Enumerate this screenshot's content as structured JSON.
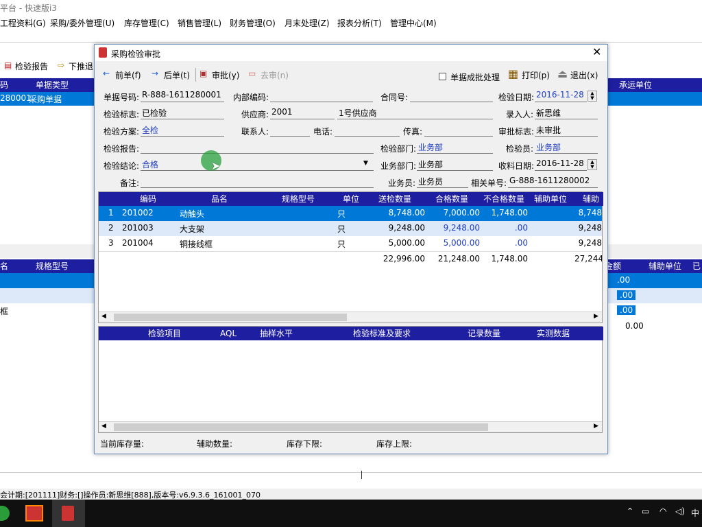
{
  "app": {
    "title": "平台 - 快速版i3",
    "menus": [
      "工程资料(G)",
      "采购/委外管理(U)",
      "库存管理(C)",
      "销售管理(L)",
      "财务管理(O)",
      "月末处理(Z)",
      "报表分析(T)",
      "管理中心(M)"
    ],
    "toolbar": {
      "inspect_report": "检验报告",
      "push_down": "下推退"
    },
    "upper_grid": {
      "headers": [
        "码",
        "单据类型",
        "承运单位"
      ],
      "row": {
        "code": "280001",
        "type": "采购单据"
      }
    },
    "lower_grid": {
      "headers": [
        "名",
        "规格型号",
        "金额",
        "辅助单位",
        "已"
      ],
      "amounts": [
        ".00",
        ".00",
        ".00",
        "0.00"
      ],
      "row3_name": "框"
    },
    "status_bar": "会计期:[201111]财务:[]操作员:新思维[888],版本号:v6.9.3.6_161001_070"
  },
  "dialog": {
    "title": "采购检验审批",
    "toolbar": {
      "prev": "前单(f)",
      "next": "后单(t)",
      "approve": "审批(y)",
      "unapprove": "去审(n)",
      "batch_checkbox": "单据成批处理",
      "print": "打印(p)",
      "exit": "退出(x)"
    },
    "fields": {
      "doc_no_label": "单据号码:",
      "doc_no": "R-888-1611280001",
      "internal_code_label": "内部编码:",
      "contract_no_label": "合同号:",
      "inspect_date_label": "检验日期:",
      "inspect_date": "2016-11-28",
      "inspect_flag_label": "检验标志:",
      "inspect_flag": "已检验",
      "supplier_label": "供应商:",
      "supplier_code": "2001",
      "supplier_name": "1号供应商",
      "entered_by_label": "录入人:",
      "entered_by": "新思维",
      "plan_label": "检验方案:",
      "plan": "全检",
      "contact_label": "联系人:",
      "phone_label": "电话:",
      "fax_label": "传真:",
      "approve_flag_label": "审批标志:",
      "approve_flag": "未审批",
      "report_label": "检验报告:",
      "inspect_dept_label": "检验部门:",
      "inspect_dept": "业务部",
      "inspector_label": "检验员:",
      "inspector": "业务部",
      "conclusion_label": "检验结论:",
      "conclusion": "合格",
      "biz_dept_label": "业务部门:",
      "biz_dept": "业务部",
      "receive_date_label": "收料日期:",
      "receive_date": "2016-11-28",
      "remark_label": "备注:",
      "salesman_label": "业务员:",
      "salesman": "业务员",
      "related_no_label": "相关单号:",
      "related_no": "G-888-1611280002"
    },
    "items_table": {
      "headers": [
        "编码",
        "品名",
        "规格型号",
        "单位",
        "送检数量",
        "合格数量",
        "不合格数量",
        "辅助单位",
        "辅助"
      ],
      "rows": [
        {
          "idx": "1",
          "code": "201002",
          "name": "动触头",
          "spec": "",
          "unit": "只",
          "sent": "8,748.00",
          "pass": "7,000.00",
          "fail": "1,748.00",
          "aux": "8,748"
        },
        {
          "idx": "2",
          "code": "201003",
          "name": "大支架",
          "spec": "",
          "unit": "只",
          "sent": "9,248.00",
          "pass": "9,248.00",
          "fail": ".00",
          "aux": "9,248"
        },
        {
          "idx": "3",
          "code": "201004",
          "name": "铜接线框",
          "spec": "",
          "unit": "只",
          "sent": "5,000.00",
          "pass": "5,000.00",
          "fail": ".00",
          "aux": "9,248"
        }
      ],
      "totals": {
        "sent": "22,996.00",
        "pass": "21,248.00",
        "fail": "1,748.00",
        "aux": "27,244"
      }
    },
    "inspect_table": {
      "headers": [
        "检验项目",
        "AQL",
        "抽样水平",
        "检验标准及要求",
        "记录数量",
        "实测数据"
      ]
    },
    "footer": {
      "stock_label": "当前库存量:",
      "aux_qty_label": "辅助数量:",
      "stock_min_label": "库存下限:",
      "stock_max_label": "库存上限:"
    }
  },
  "taskbar": {
    "ime": "中"
  }
}
